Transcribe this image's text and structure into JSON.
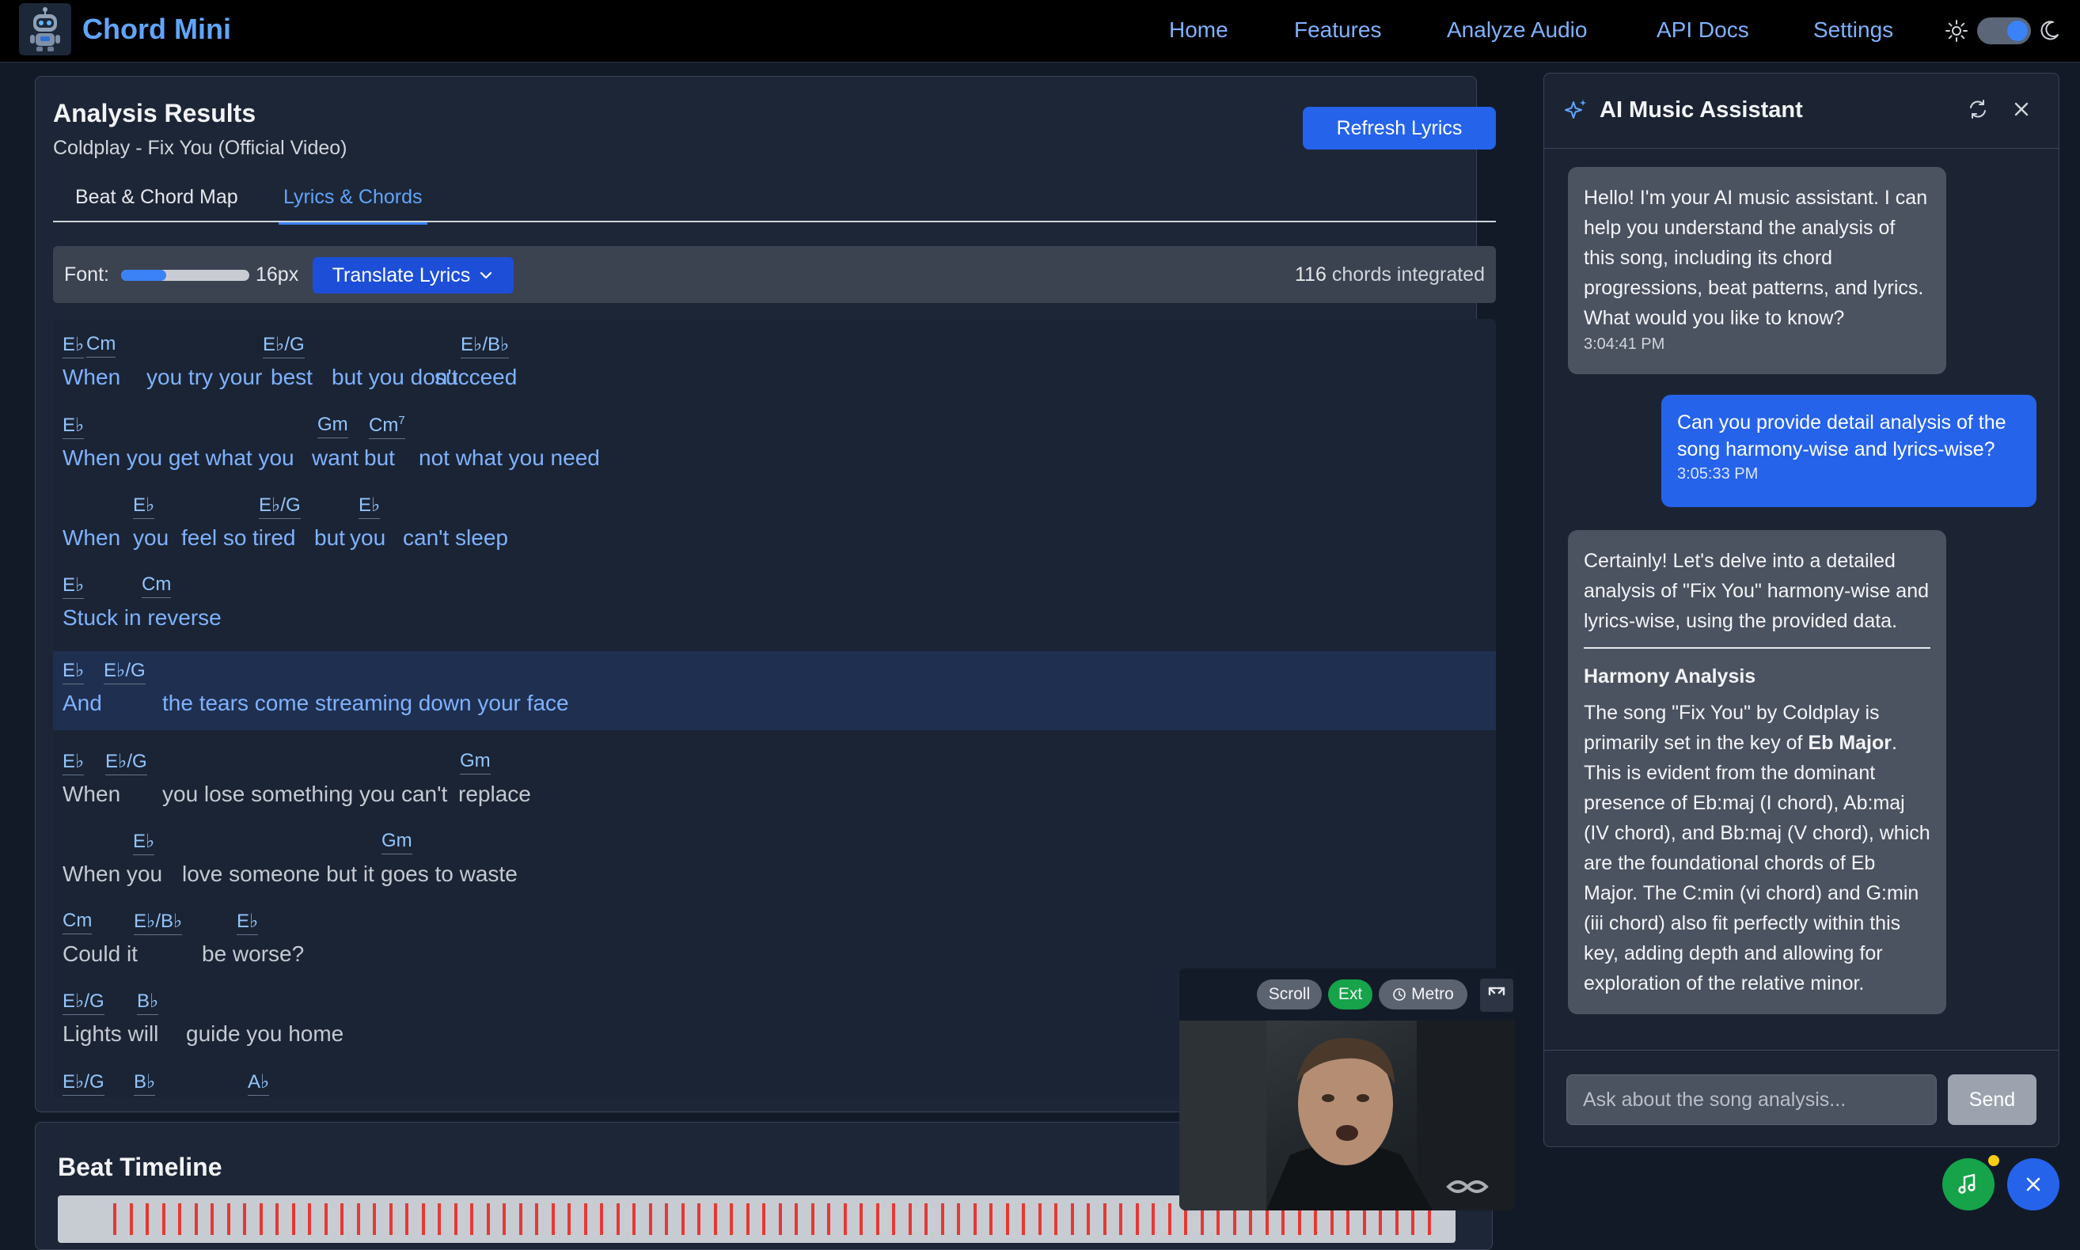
{
  "app": {
    "name": "Chord Mini"
  },
  "nav": {
    "links": [
      "Home",
      "Features",
      "Analyze Audio",
      "API Docs",
      "Settings"
    ]
  },
  "analysis": {
    "title": "Analysis Results",
    "song": "Coldplay - Fix You (Official Video)",
    "refresh_label": "Refresh Lyrics",
    "tabs": [
      "Beat & Chord Map",
      "Lyrics & Chords"
    ],
    "active_tab": "Lyrics & Chords"
  },
  "toolbar": {
    "font_label": "Font:",
    "font_size": "16px",
    "font_slider_fraction": 0.35,
    "translate_label": "Translate Lyrics",
    "chord_count": "116",
    "chord_count_suffix": "chords integrated"
  },
  "lyrics": [
    {
      "highlight": false,
      "chords": [
        {
          "t": "E♭"
        },
        {
          "t": "Cm"
        },
        {
          "t": "E♭/G"
        },
        {
          "t": "E♭/B♭"
        }
      ],
      "words": [
        {
          "t": "When",
          "c": "blue"
        },
        {
          "t": "you try your",
          "c": "blue"
        },
        {
          "t": "best",
          "c": "blue"
        },
        {
          "t": "but you don't",
          "c": "blue"
        },
        {
          "t": "succeed",
          "c": "blue"
        }
      ]
    },
    {
      "highlight": false,
      "chords": [
        {
          "t": "E♭"
        },
        {
          "t": "Gm"
        },
        {
          "t": "Cm",
          "sup": "7"
        }
      ],
      "words": [
        {
          "t": "When you get what you",
          "c": "blue"
        },
        {
          "t": "want",
          "c": "blue"
        },
        {
          "t": "but",
          "c": "blue"
        },
        {
          "t": "not what you need",
          "c": "blue"
        }
      ]
    },
    {
      "highlight": false,
      "chords": [
        {
          "t": "E♭"
        },
        {
          "t": "E♭/G"
        },
        {
          "t": "E♭"
        }
      ],
      "words": [
        {
          "t": "When",
          "c": "blue"
        },
        {
          "t": "you",
          "c": "blue"
        },
        {
          "t": "feel so",
          "c": "blue"
        },
        {
          "t": "tired",
          "c": "blue"
        },
        {
          "t": "but",
          "c": "blue"
        },
        {
          "t": "you",
          "c": "blue"
        },
        {
          "t": "can't sleep",
          "c": "blue"
        }
      ]
    },
    {
      "highlight": false,
      "chords": [
        {
          "t": "E♭"
        },
        {
          "t": "Cm"
        }
      ],
      "words": [
        {
          "t": "Stuck in reverse",
          "c": "blue"
        }
      ]
    },
    {
      "highlight": true,
      "chords": [
        {
          "t": "E♭"
        },
        {
          "t": "E♭/G"
        }
      ],
      "words": [
        {
          "t": "And",
          "c": "blue"
        },
        {
          "t": "the tears come streaming down your face",
          "c": "blue"
        }
      ]
    },
    {
      "highlight": false,
      "chords": [
        {
          "t": "E♭"
        },
        {
          "t": "E♭/G"
        },
        {
          "t": "Gm"
        }
      ],
      "words": [
        {
          "t": "When",
          "c": "gray"
        },
        {
          "t": "you lose something you can't",
          "c": "gray"
        },
        {
          "t": "replace",
          "c": "gray"
        }
      ]
    },
    {
      "highlight": false,
      "chords": [
        {
          "t": "E♭"
        },
        {
          "t": "Gm"
        }
      ],
      "words": [
        {
          "t": "When you",
          "c": "gray"
        },
        {
          "t": "love someone but it",
          "c": "gray"
        },
        {
          "t": "goes to waste",
          "c": "gray"
        }
      ]
    },
    {
      "highlight": false,
      "chords": [
        {
          "t": "Cm"
        },
        {
          "t": "E♭/B♭"
        },
        {
          "t": "E♭"
        }
      ],
      "words": [
        {
          "t": "Could it",
          "c": "gray"
        },
        {
          "t": "be worse?",
          "c": "gray"
        }
      ]
    },
    {
      "highlight": false,
      "chords": [
        {
          "t": "E♭/G"
        },
        {
          "t": "B♭"
        }
      ],
      "words": [
        {
          "t": "Lights will",
          "c": "gray"
        },
        {
          "t": "guide you home",
          "c": "gray"
        }
      ]
    },
    {
      "highlight": false,
      "chords": [
        {
          "t": "E♭/G"
        },
        {
          "t": "B♭"
        },
        {
          "t": "A♭"
        }
      ],
      "words": []
    }
  ],
  "beat_timeline": {
    "title": "Beat Timeline"
  },
  "video": {
    "pills": [
      "Scroll",
      "Ext",
      "Metro"
    ]
  },
  "assistant": {
    "title": "AI Music Assistant",
    "messages": {
      "m1": {
        "text": "Hello! I'm your AI music assistant. I can help you understand the analysis of this song, including its chord progressions, beat patterns, and lyrics. What would you like to know?",
        "time": "3:04:41 PM"
      },
      "m2": {
        "text": "Can you provide detail analysis of the song harmony-wise and lyrics-wise?",
        "time": "3:05:33 PM"
      },
      "m3": {
        "intro": "Certainly! Let's delve into a detailed analysis of \"Fix You\" harmony-wise and lyrics-wise, using the provided data.",
        "heading": "Harmony Analysis",
        "p_pre": "The song \"Fix You\" by Coldplay is primarily set in the key of ",
        "p_key": "Eb Major",
        "p_post": ". This is evident from the dominant presence of Eb:maj (I chord), Ab:maj (IV chord), and Bb:maj (V chord), which are the foundational chords of Eb Major. The C:min (vi chord) and G:min (iii chord) also fit perfectly within this key, adding depth and allowing for exploration of the relative minor."
      }
    },
    "input_placeholder": "Ask about the song analysis...",
    "send_label": "Send"
  },
  "colors": {
    "accent": "#3b82f6",
    "brand": "#60a5fa",
    "chord": "#93c5fd",
    "lyric_active": "#7fb2ff",
    "lyric_inactive": "#c4c9d2",
    "beat_marker": "#e53935",
    "ext_pill": "#16a34a"
  }
}
